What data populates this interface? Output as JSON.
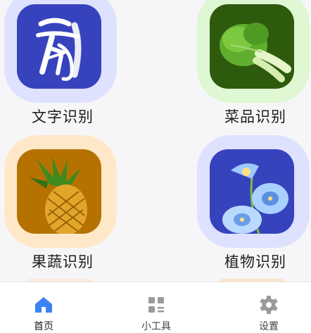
{
  "cards": [
    {
      "label": "文字识别",
      "icon": "calligraphy-character-icon",
      "halo": "#dfe2ff",
      "tile": "#3743bd"
    },
    {
      "label": "菜品识别",
      "icon": "bok-choy-icon",
      "halo": "#dff7d2",
      "tile": "#2e5a0d"
    },
    {
      "label": "果蔬识别",
      "icon": "pineapple-icon",
      "halo": "#ffe8c8",
      "tile": "#b57200"
    },
    {
      "label": "植物识别",
      "icon": "morning-glory-flower-icon",
      "halo": "#dfe2ff",
      "tile": "#3743bd"
    }
  ],
  "tabbar": {
    "active_color": "#3b82f6",
    "inactive_color": "#9a9a9a",
    "items": [
      {
        "label": "首页",
        "icon": "home-icon",
        "active": true
      },
      {
        "label": "小工具",
        "icon": "grid-tools-icon",
        "active": false
      },
      {
        "label": "设置",
        "icon": "gear-icon",
        "active": false
      }
    ]
  }
}
